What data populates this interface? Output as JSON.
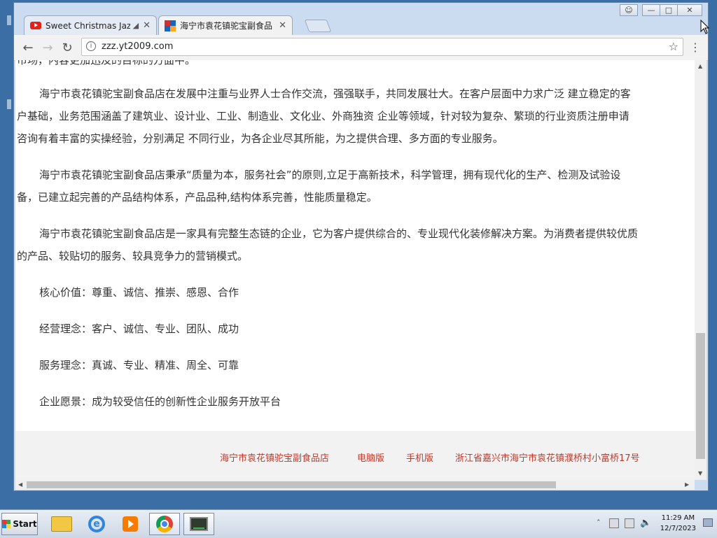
{
  "browser": {
    "tabs": [
      {
        "title": "Sweet Christmas Jazz",
        "icon": "youtube-icon",
        "audio": true,
        "active": false
      },
      {
        "title": "海宁市袁花镇驼宝副食品",
        "icon": "site-favicon",
        "active": true
      }
    ],
    "url": "zzz.yt2009.com"
  },
  "page": {
    "partial_top": "市场，内容更加迅及的目标的方面中。",
    "paragraphs": [
      "海宁市袁花镇驼宝副食品店在发展中注重与业界人士合作交流，强强联手，共同发展壮大。在客户层面中力求广泛 建立稳定的客户基础，业务范围涵盖了建筑业、设计业、工业、制造业、文化业、外商独资 企业等领域，针对较为复杂、繁琐的行业资质注册申请咨询有着丰富的实操经验，分别满足 不同行业，为各企业尽其所能，为之提供合理、多方面的专业服务。",
      "海宁市袁花镇驼宝副食品店秉承“质量为本，服务社会”的原则,立足于高新技术，科学管理，拥有现代化的生产、检测及试验设备，已建立起完善的产品结构体系，产品品种,结构体系完善，性能质量稳定。",
      "海宁市袁花镇驼宝副食品店是一家具有完整生态链的企业，它为客户提供综合的、专业现代化装修解决方案。为消费者提供较优质的产品、较贴切的服务、较具竞争力的营销模式。"
    ],
    "values": [
      "核心价值：尊重、诚信、推崇、感恩、合作",
      "经营理念：客户、诚信、专业、团队、成功",
      "服务理念：真诚、专业、精准、周全、可靠",
      "企业愿景：成为较受信任的创新性企业服务开放平台"
    ],
    "footer": {
      "company": "海宁市袁花镇驼宝副食品店",
      "pc": "电脑版",
      "mobile": "手机版",
      "address": "浙江省嘉兴市海宁市袁花镇濮桥村小富桥17号"
    }
  },
  "taskbar": {
    "start_label": "Start",
    "time": "11:29 AM",
    "date": "12/7/2023"
  }
}
